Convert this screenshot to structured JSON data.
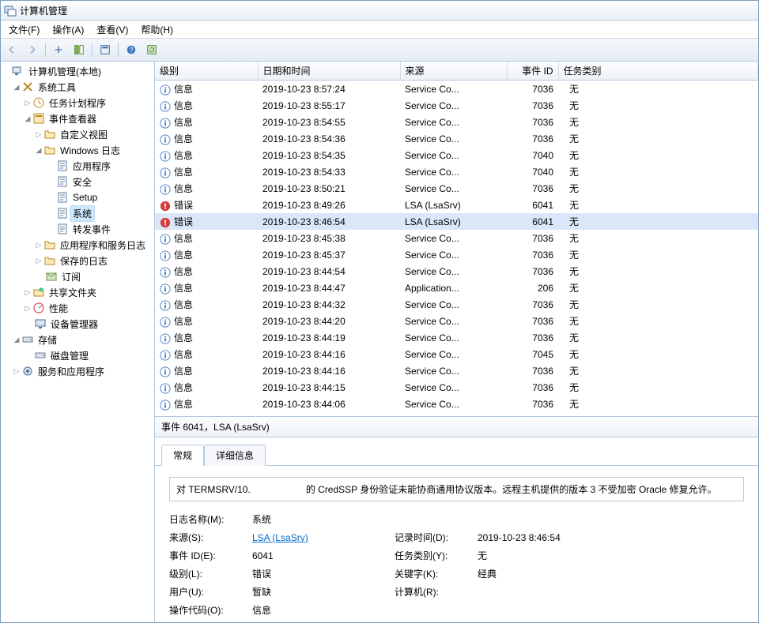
{
  "title": "计算机管理",
  "menu": {
    "file": "文件(F)",
    "action": "操作(A)",
    "view": "查看(V)",
    "help": "帮助(H)"
  },
  "tree": {
    "root": "计算机管理(本地)",
    "systools": "系统工具",
    "tasksched": "任务计划程序",
    "eventvwr": "事件查看器",
    "customviews": "自定义视图",
    "winlogs": "Windows 日志",
    "app": "应用程序",
    "security": "安全",
    "setup": "Setup",
    "system": "系统",
    "forwarded": "转发事件",
    "appsvclogs": "应用程序和服务日志",
    "savedlogs": "保存的日志",
    "subs": "订阅",
    "shared": "共享文件夹",
    "perf": "性能",
    "devmgr": "设备管理器",
    "storage": "存储",
    "diskmgmt": "磁盘管理",
    "services": "服务和应用程序"
  },
  "headers": {
    "level": "级别",
    "datetime": "日期和时间",
    "source": "来源",
    "eventid": "事件 ID",
    "category": "任务类别"
  },
  "rows": [
    {
      "t": "info",
      "level": "信息",
      "dt": "2019-10-23 8:57:24",
      "src": "Service Co...",
      "id": "7036",
      "cat": "无"
    },
    {
      "t": "info",
      "level": "信息",
      "dt": "2019-10-23 8:55:17",
      "src": "Service Co...",
      "id": "7036",
      "cat": "无"
    },
    {
      "t": "info",
      "level": "信息",
      "dt": "2019-10-23 8:54:55",
      "src": "Service Co...",
      "id": "7036",
      "cat": "无"
    },
    {
      "t": "info",
      "level": "信息",
      "dt": "2019-10-23 8:54:36",
      "src": "Service Co...",
      "id": "7036",
      "cat": "无"
    },
    {
      "t": "info",
      "level": "信息",
      "dt": "2019-10-23 8:54:35",
      "src": "Service Co...",
      "id": "7040",
      "cat": "无"
    },
    {
      "t": "info",
      "level": "信息",
      "dt": "2019-10-23 8:54:33",
      "src": "Service Co...",
      "id": "7040",
      "cat": "无"
    },
    {
      "t": "info",
      "level": "信息",
      "dt": "2019-10-23 8:50:21",
      "src": "Service Co...",
      "id": "7036",
      "cat": "无"
    },
    {
      "t": "error",
      "level": "错误",
      "dt": "2019-10-23 8:49:26",
      "src": "LSA (LsaSrv)",
      "id": "6041",
      "cat": "无"
    },
    {
      "t": "error",
      "level": "错误",
      "dt": "2019-10-23 8:46:54",
      "src": "LSA (LsaSrv)",
      "id": "6041",
      "cat": "无",
      "selected": true
    },
    {
      "t": "info",
      "level": "信息",
      "dt": "2019-10-23 8:45:38",
      "src": "Service Co...",
      "id": "7036",
      "cat": "无"
    },
    {
      "t": "info",
      "level": "信息",
      "dt": "2019-10-23 8:45:37",
      "src": "Service Co...",
      "id": "7036",
      "cat": "无"
    },
    {
      "t": "info",
      "level": "信息",
      "dt": "2019-10-23 8:44:54",
      "src": "Service Co...",
      "id": "7036",
      "cat": "无"
    },
    {
      "t": "info",
      "level": "信息",
      "dt": "2019-10-23 8:44:47",
      "src": "Application...",
      "id": "206",
      "cat": "无"
    },
    {
      "t": "info",
      "level": "信息",
      "dt": "2019-10-23 8:44:32",
      "src": "Service Co...",
      "id": "7036",
      "cat": "无"
    },
    {
      "t": "info",
      "level": "信息",
      "dt": "2019-10-23 8:44:20",
      "src": "Service Co...",
      "id": "7036",
      "cat": "无"
    },
    {
      "t": "info",
      "level": "信息",
      "dt": "2019-10-23 8:44:19",
      "src": "Service Co...",
      "id": "7036",
      "cat": "无"
    },
    {
      "t": "info",
      "level": "信息",
      "dt": "2019-10-23 8:44:16",
      "src": "Service Co...",
      "id": "7045",
      "cat": "无"
    },
    {
      "t": "info",
      "level": "信息",
      "dt": "2019-10-23 8:44:16",
      "src": "Service Co...",
      "id": "7036",
      "cat": "无"
    },
    {
      "t": "info",
      "level": "信息",
      "dt": "2019-10-23 8:44:15",
      "src": "Service Co...",
      "id": "7036",
      "cat": "无"
    },
    {
      "t": "info",
      "level": "信息",
      "dt": "2019-10-23 8:44:06",
      "src": "Service Co...",
      "id": "7036",
      "cat": "无"
    }
  ],
  "detail": {
    "title": "事件 6041，LSA (LsaSrv)",
    "tab_general": "常规",
    "tab_details": "详细信息",
    "msg_a": "对 TERMSRV/10.",
    "msg_b": "的 CredSSP 身份验证未能协商通用协议版本。远程主机提供的版本 3 不受加密 Oracle 修复允许。",
    "p": {
      "logname_l": "日志名称(M):",
      "logname_v": "系统",
      "source_l": "来源(S):",
      "source_v": "LSA (LsaSrv)",
      "logged_l": "记录时间(D):",
      "logged_v": "2019-10-23 8:46:54",
      "eventid_l": "事件 ID(E):",
      "eventid_v": "6041",
      "cat_l": "任务类别(Y):",
      "cat_v": "无",
      "level_l": "级别(L):",
      "level_v": "错误",
      "kw_l": "关键字(K):",
      "kw_v": "经典",
      "user_l": "用户(U):",
      "user_v": "暂缺",
      "comp_l": "计算机(R):",
      "comp_v": "",
      "opcode_l": "操作代码(O):",
      "opcode_v": "信息"
    }
  }
}
